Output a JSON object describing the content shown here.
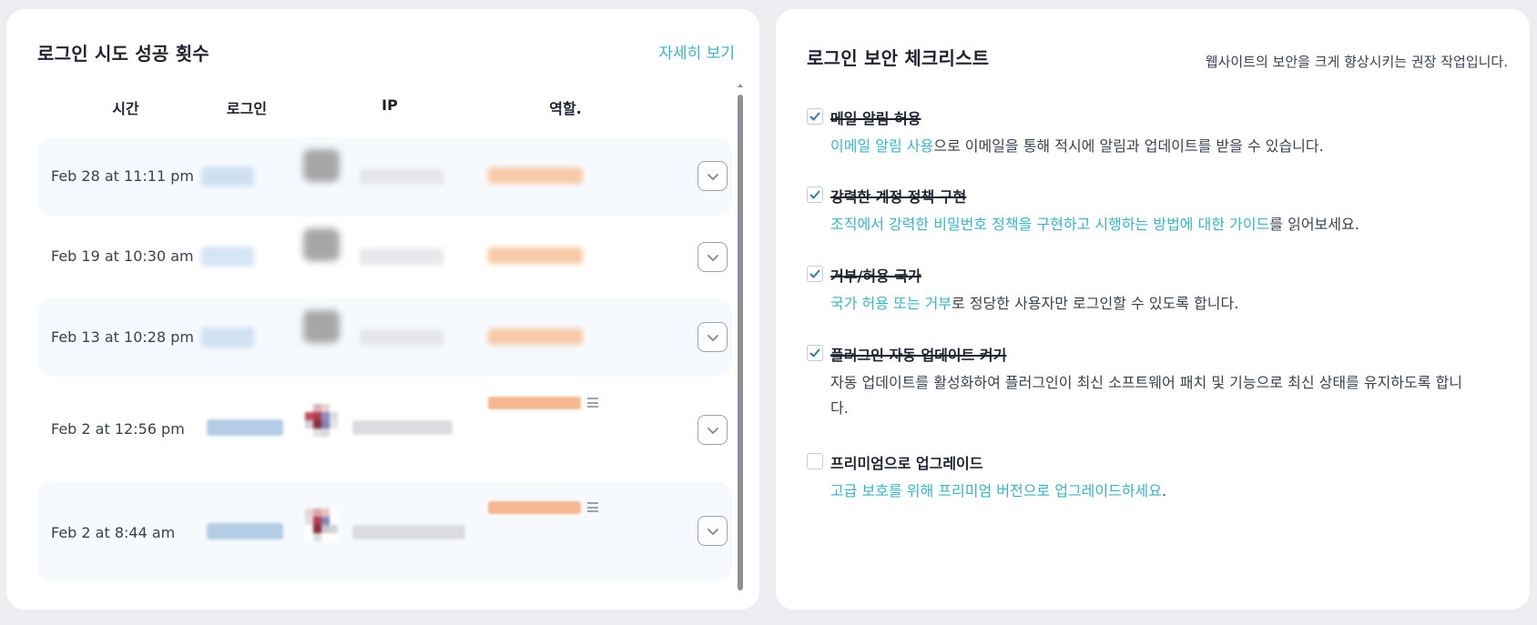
{
  "left_panel": {
    "title": "로그인 시도 성공 횟수",
    "more_link": "자세히 보기",
    "columns": [
      "시간",
      "로그인",
      "IP",
      "역할."
    ],
    "rows": [
      {
        "time": "Feb 28 at 11:11 pm"
      },
      {
        "time": "Feb 19 at 10:30 am"
      },
      {
        "time": "Feb 13 at 10:28 pm"
      },
      {
        "time": "Feb 2 at 12:56 pm"
      },
      {
        "time": "Feb 2 at 8:44 am"
      }
    ]
  },
  "right_panel": {
    "title": "로그인 보안 체크리스트",
    "description": "웹사이트의 보안을 크게 향상시키는 권장 작업입니다.",
    "items": [
      {
        "checked": true,
        "title": "메일 알림 허용",
        "desc_link": "이메일 알림 사용",
        "desc_text": "으로 이메일을 통해 적시에 알림과 업데이트를 받을 수 있습니다."
      },
      {
        "checked": true,
        "title": "강력한 계정 정책 구현",
        "desc_link": "조직에서 강력한 비밀번호 정책을 구현하고 시행하는 방법에 대한 가이드",
        "desc_text": "를 읽어보세요."
      },
      {
        "checked": true,
        "title": "거부/허용 국가",
        "desc_link": "국가 허용 또는 거부",
        "desc_text": "로 정당한 사용자만 로그인할 수 있도록 합니다."
      },
      {
        "checked": true,
        "title": "플러그인 자동 업데이트 켜기",
        "desc_link": "",
        "desc_text": "자동 업데이트를 활성화하여 플러그인이 최신 소프트웨어 패치 및 기능으로 최신 상태를 유지하도록 합니다."
      },
      {
        "checked": false,
        "title": "프리미엄으로 업그레이드",
        "desc_link": "고급 보호를 위해 프리미엄 버전으로 업그레이드하세요",
        "desc_text": "."
      }
    ]
  },
  "colors": {
    "accent": "#35b6c7",
    "checkmark": "#2b7bb9",
    "row_shade": "#f6faff",
    "role_blur": "#f8c39c",
    "login_blur": "#bfd6ec"
  },
  "icons": {
    "expand": "chevron-down-icon",
    "check": "checkmark-icon",
    "role_menu": "menu-lines-icon"
  }
}
